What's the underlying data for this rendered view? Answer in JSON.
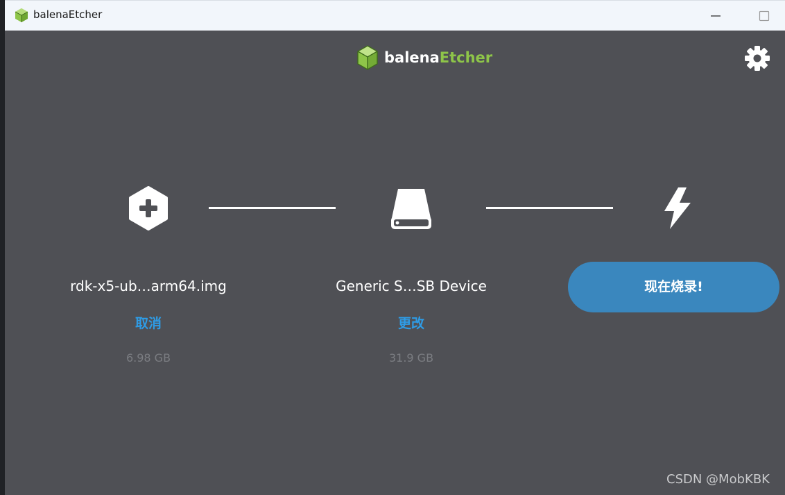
{
  "window": {
    "title": "balenaEtcher",
    "icons": {
      "app": "balena-cube-icon",
      "minimize": "minimize-icon",
      "maximize": "maximize-icon"
    }
  },
  "header": {
    "brand_part1": "balena",
    "brand_part2": "Etcher",
    "brand_colors": {
      "primary": "#ffffff",
      "accent": "#8ec549"
    },
    "settings_icon": "gear-icon"
  },
  "steps": {
    "source": {
      "icon": "plus-hexagon-icon",
      "filename": "rdk-x5-ub…arm64.img",
      "action": "取消",
      "size": "6.98 GB"
    },
    "target": {
      "icon": "drive-icon",
      "device": "Generic S…SB Device",
      "action": "更改",
      "size": "31.9 GB"
    },
    "flash": {
      "icon": "lightning-icon",
      "button_label": "现在烧录!"
    }
  },
  "colors": {
    "background": "#4f5055",
    "link": "#2e9ce6",
    "flash_button": "#3a87be",
    "muted_text": "#7b7d82"
  },
  "watermark": "CSDN @MobKBK"
}
